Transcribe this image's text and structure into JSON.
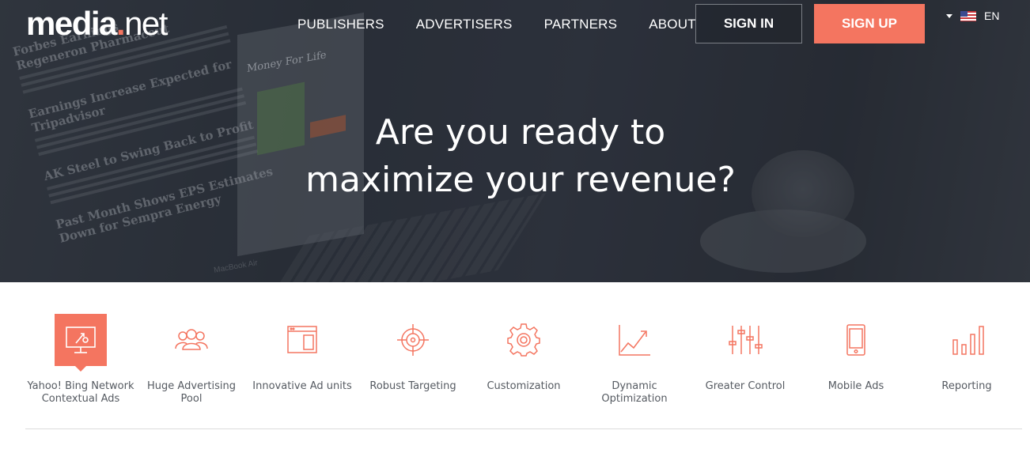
{
  "header": {
    "logo": {
      "media": "media",
      "dot": ".",
      "net": "net"
    },
    "nav": [
      "PUBLISHERS",
      "ADVERTISERS",
      "PARTNERS",
      "ABOUT"
    ],
    "sign_in": "SIGN IN",
    "sign_up": "SIGN UP",
    "language": "EN",
    "flag_icon": "us-flag-icon"
  },
  "hero": {
    "headline_line1": "Are you ready to",
    "headline_line2": "maximize your revenue?",
    "background_text": {
      "headlines": [
        "Forbes Earnings",
        "Regeneron Pharmaceut",
        "Earnings Increase Expected for",
        "Tripadvisor",
        "AK Steel to Swing Back to Profit",
        "Past Month Shows EPS Estimates",
        "Down for Sempra Energy"
      ],
      "money_for_life": "Money For Life",
      "brand": "MacBook Air"
    }
  },
  "features": [
    {
      "label": "Yahoo! Bing Network Contextual Ads",
      "icon": "monitor-icon",
      "active": true
    },
    {
      "label": "Huge Advertising Pool",
      "icon": "users-icon",
      "active": false
    },
    {
      "label": "Innovative Ad units",
      "icon": "ad-unit-icon",
      "active": false
    },
    {
      "label": "Robust Targeting",
      "icon": "target-icon",
      "active": false
    },
    {
      "label": "Customization",
      "icon": "gear-icon",
      "active": false
    },
    {
      "label": "Dynamic Optimization",
      "icon": "line-chart-icon",
      "active": false
    },
    {
      "label": "Greater Control",
      "icon": "sliders-icon",
      "active": false
    },
    {
      "label": "Mobile Ads",
      "icon": "mobile-icon",
      "active": false
    },
    {
      "label": "Reporting",
      "icon": "bar-chart-icon",
      "active": false
    }
  ],
  "colors": {
    "accent": "#f47560",
    "text": "#555a61",
    "hero_bg": "#353944"
  }
}
